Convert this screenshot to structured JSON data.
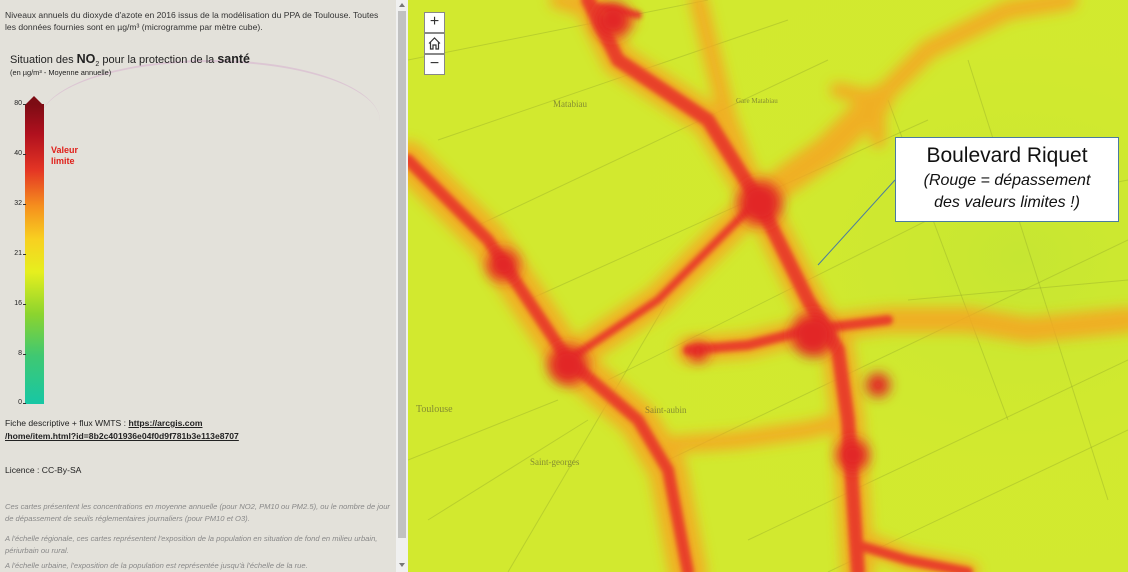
{
  "sidebar": {
    "intro": "Niveaux annuels du dioxyde d'azote en 2016 issus de la modélisation du PPA de Toulouse. Toutes les données fournies sont en µg/m³ (microgramme par mètre cube).",
    "legend": {
      "title_pre": "Situation des ",
      "title_no": "NO",
      "title_sub": "2",
      "title_mid": " pour la protection de la ",
      "title_sante": "santé",
      "subtitle": "(en µg/m³ - Moyenne annuelle)",
      "ticks": [
        "80",
        "40",
        "32",
        "21",
        "16",
        "8",
        "0"
      ],
      "limit_label_1": "Valeur",
      "limit_label_2": "limite"
    },
    "fiche_label": "Fiche descriptive + flux WMTS : ",
    "fiche_link_1": "https://arcgis.com",
    "fiche_link_2": "/home/item.html?id=8b2c401936e04f0d9f781b3e113e8707",
    "licence": "Licence : CC-By-SA",
    "note_1": "Ces cartes présentent les concentrations en moyenne annuelle (pour NO2, PM10 ou PM2.5), ou le nombre de jour de dépassement de seuils réglementaires journaliers (pour PM10 et O3).",
    "note_2": "A l'échelle régionale, ces cartes représentent l'exposition de la population en situation de fond en milieu urbain, périurbain ou rural.",
    "note_3": "A l'échelle urbaine, l'exposition de la population est représentée jusqu'à l'échelle de la rue."
  },
  "map": {
    "zoom_in": "+",
    "zoom_out": "−",
    "callout_title": "Boulevard Riquet",
    "callout_line1": "(Rouge = dépassement",
    "callout_line2": "des valeurs limites !)",
    "labels": {
      "matabiau": "Matabiau",
      "gare": "Gare Matabiau",
      "toulouse": "Toulouse",
      "saint_aubin": "Saint-aubin",
      "saint_georges": "Saint-georges"
    }
  },
  "colors": {
    "limit_red": "#e0201a",
    "callout_border": "#4a7ba0"
  }
}
